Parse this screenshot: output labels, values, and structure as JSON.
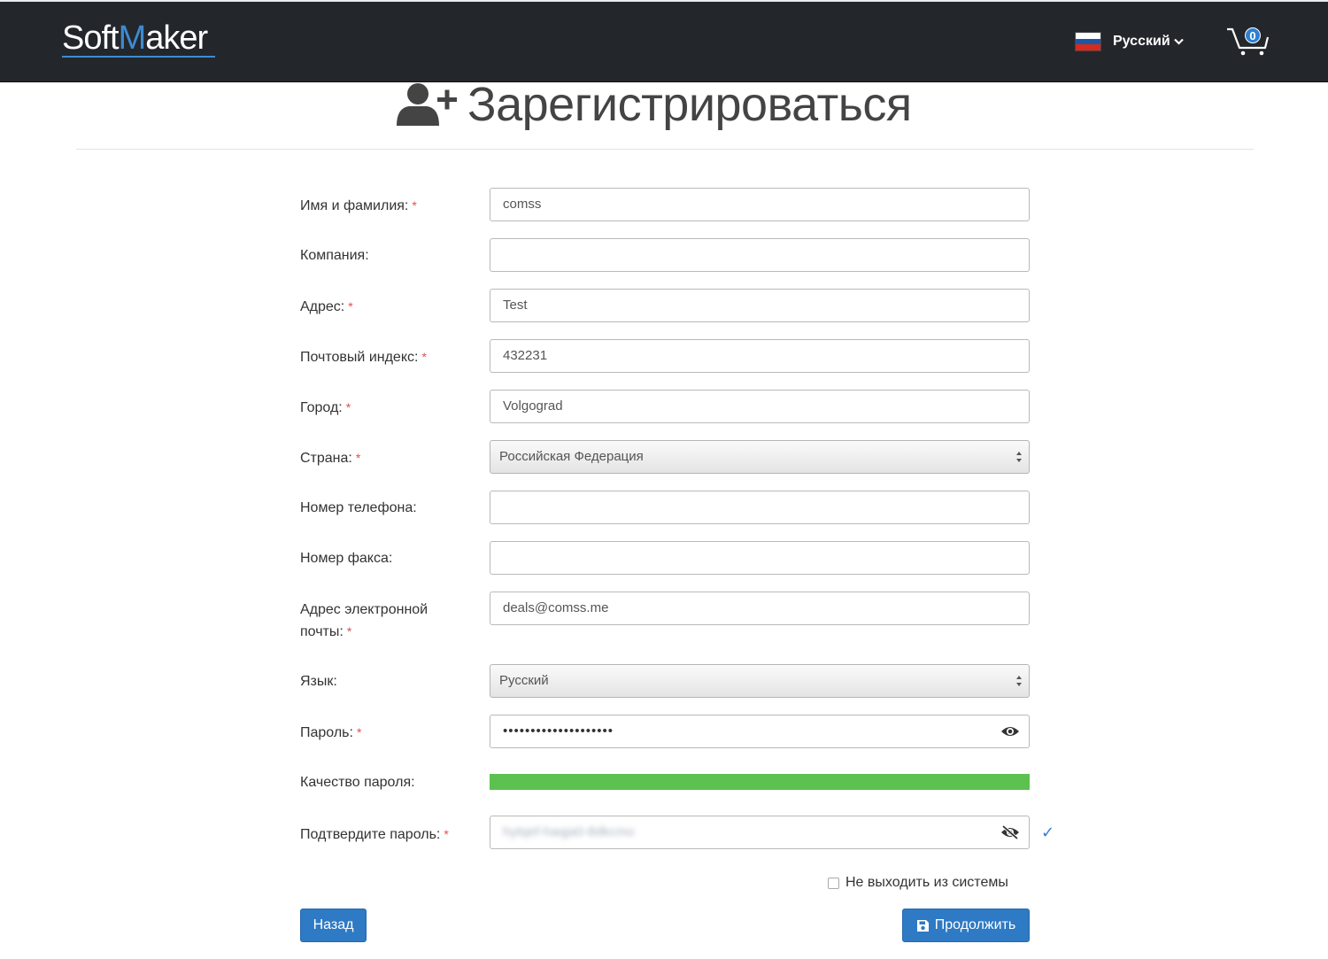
{
  "header": {
    "logo_soft": "Soft",
    "logo_m": "M",
    "logo_aker": "aker",
    "language_label": "Русский",
    "cart_count": "0",
    "flag": "russia-flag-icon",
    "colors": {
      "bar": "#23272b",
      "accent": "#3d8bd4"
    }
  },
  "page": {
    "title": "Зарегистрироваться",
    "title_icon": "user-plus-icon"
  },
  "form": {
    "required_mark": "*",
    "fields": [
      {
        "label": "Имя и фамилия:",
        "required": true,
        "value": "comss"
      },
      {
        "label": "Компания:",
        "required": false,
        "value": ""
      },
      {
        "label": "Адрес:",
        "required": true,
        "value": "Test"
      },
      {
        "label": "Почтовый индекс:",
        "required": true,
        "value": "432231"
      },
      {
        "label": "Город:",
        "required": true,
        "value": "Volgograd"
      },
      {
        "label": "Страна:",
        "required": true,
        "value": "Российская Федерация",
        "type": "select"
      },
      {
        "label": "Номер телефона:",
        "required": false,
        "value": ""
      },
      {
        "label": "Номер факса:",
        "required": false,
        "value": ""
      },
      {
        "label_line1": "Адрес электронной",
        "label_line2": "почты:",
        "required": true,
        "value": "deals@comss.me"
      },
      {
        "label": "Язык:",
        "required": false,
        "value": "Русский",
        "type": "select"
      },
      {
        "label": "Пароль:",
        "required": true,
        "value": "••••••••••••••••••••",
        "type": "password"
      },
      {
        "label": "Качество пароля:",
        "strength": 1.0,
        "strength_color": "#5cc14f"
      },
      {
        "label": "Подтвердите пароль:",
        "required": true,
        "value": "hytqef-haqja0-8dkcmo",
        "type": "password-visible",
        "valid": true
      }
    ],
    "check_mark": "✓",
    "stay_logged_in": {
      "label": "Не выходить из системы",
      "checked": false
    }
  },
  "buttons": {
    "back": "Назад",
    "continue": "Продолжить",
    "color": "#2e7ac4"
  }
}
